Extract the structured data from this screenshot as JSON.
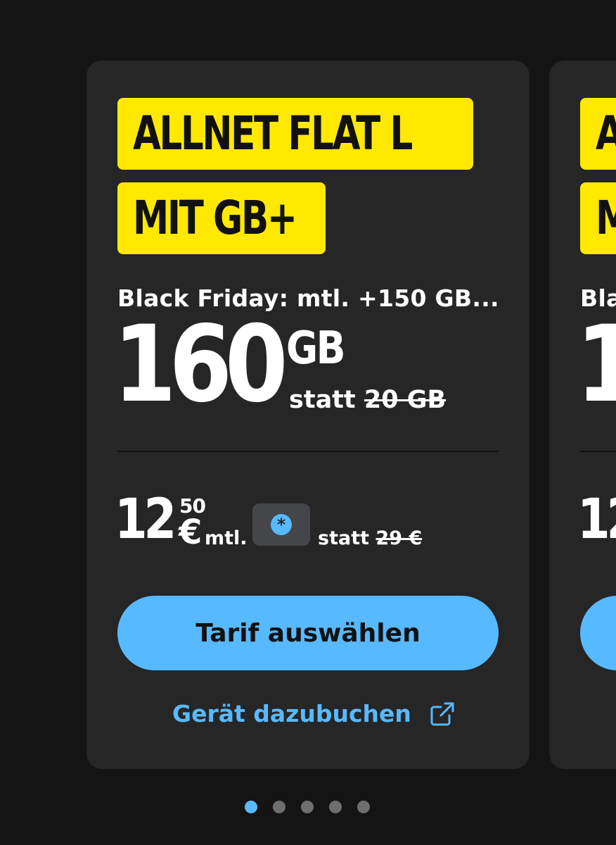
{
  "tariff": {
    "title_line1": "ALLNET FLAT L",
    "title_line2": "MIT GB+",
    "promo": "Black Friday: mtl. +150 GB...",
    "data_amount": "160",
    "data_unit": "GB",
    "data_statt_label": "statt",
    "data_old": "20 GB",
    "price_euros": "12",
    "price_cents": "50",
    "price_currency": "€",
    "price_period": "mtl.",
    "info_symbol": "*",
    "price_statt_label": "statt",
    "price_old": "29 €",
    "cta_label": "Tarif auswählen",
    "device_link_label": "Gerät dazubuchen"
  },
  "peek": {
    "title_line1": "A",
    "title_line2": "M",
    "promo": "Bla",
    "data_amount": "1",
    "price_euros": "12"
  },
  "pagination": {
    "count": 5,
    "active": 0
  },
  "colors": {
    "background": "#141414",
    "card": "#262626",
    "badge": "#ffe900",
    "accent": "#57b9ff"
  }
}
